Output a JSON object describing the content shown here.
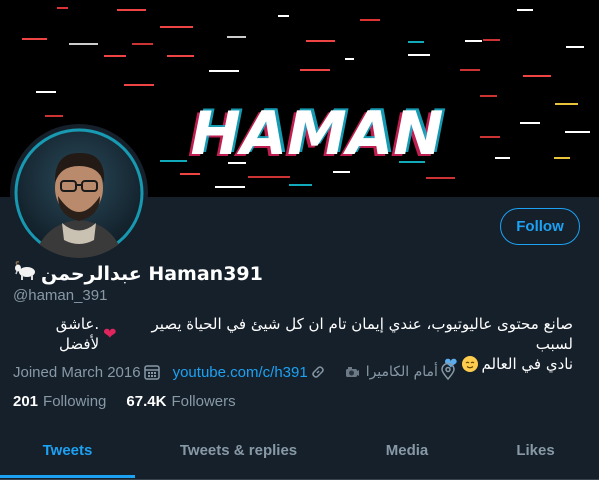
{
  "banner": {
    "text": "HAMAN"
  },
  "profile": {
    "display_name": "عبدالرحمن Haman391",
    "handle": "@haman_391",
    "bio_line1": "صانع محتوى عاليوتيوب، عندي إيمان تام ان كل شيئ في الحياة يصير لسبب",
    "bio_line1_end": ".عاشق لأفضل",
    "bio_line2": "نادي في العالم",
    "joined": "Joined March 2016",
    "website": "youtube.com/c/h391",
    "location": "أمام الكاميرا"
  },
  "actions": {
    "follow_label": "Follow"
  },
  "stats": {
    "following_count": "201",
    "following_label": "Following",
    "followers_count": "67.4K",
    "followers_label": "Followers"
  },
  "tabs": [
    {
      "label": "Tweets",
      "active": true
    },
    {
      "label": "Tweets & replies",
      "active": false
    },
    {
      "label": "Media",
      "active": false
    },
    {
      "label": "Likes",
      "active": false
    }
  ],
  "colors": {
    "background": "#15202b",
    "accent": "#1da1f2",
    "muted": "#8899a6",
    "heart": "#e0245e"
  },
  "icons": [
    "goat-icon",
    "calendar-icon",
    "link-icon",
    "camera-icon",
    "location-icon",
    "red-heart-icon",
    "relieved-face-icon",
    "blue-heart-icon"
  ]
}
